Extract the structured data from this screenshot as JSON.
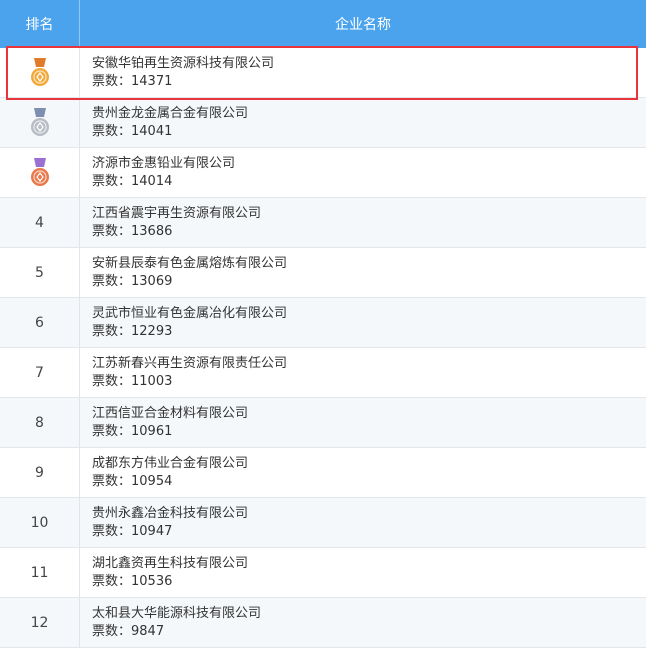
{
  "header": {
    "rank_label": "排名",
    "name_label": "企业名称"
  },
  "votes_prefix": "票数：",
  "colors": {
    "header_bg": "#4aa3ec",
    "highlight": "#e8343b",
    "gold": "#f2a93b",
    "silver": "#b7bcc5",
    "bronze": "#e8794a",
    "ribbon_purple": "#9a6fd1"
  },
  "rows": [
    {
      "rank": "1",
      "medal": "gold-medal-icon",
      "company": "安徽华铂再生资源科技有限公司",
      "votes": "14371"
    },
    {
      "rank": "2",
      "medal": "silver-medal-icon",
      "company": "贵州金龙金属合金有限公司",
      "votes": "14041"
    },
    {
      "rank": "3",
      "medal": "bronze-medal-icon",
      "company": "济源市金惠铅业有限公司",
      "votes": "14014"
    },
    {
      "rank": "4",
      "company": "江西省震宇再生资源有限公司",
      "votes": "13686"
    },
    {
      "rank": "5",
      "company": "安新县辰泰有色金属熔炼有限公司",
      "votes": "13069"
    },
    {
      "rank": "6",
      "company": "灵武市恒业有色金属冶化有限公司",
      "votes": "12293"
    },
    {
      "rank": "7",
      "company": "江苏新春兴再生资源有限责任公司",
      "votes": "11003"
    },
    {
      "rank": "8",
      "company": "江西信亚合金材料有限公司",
      "votes": "10961"
    },
    {
      "rank": "9",
      "company": "成都东方伟业合金有限公司",
      "votes": "10954"
    },
    {
      "rank": "10",
      "company": "贵州永鑫冶金科技有限公司",
      "votes": "10947"
    },
    {
      "rank": "11",
      "company": "湖北鑫资再生科技有限公司",
      "votes": "10536"
    },
    {
      "rank": "12",
      "company": "太和县大华能源科技有限公司",
      "votes": "9847"
    }
  ]
}
